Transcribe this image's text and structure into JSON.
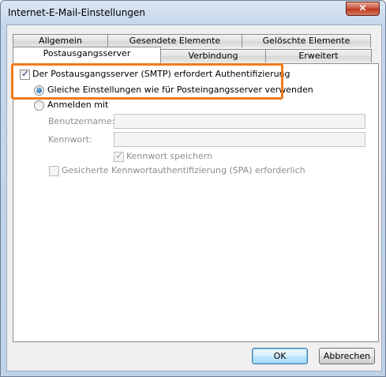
{
  "window": {
    "title": "Internet-E-Mail-Einstellungen",
    "close_icon": "×"
  },
  "tabs": {
    "row1": [
      "Allgemein",
      "Gesendete Elemente",
      "Gelöschte Elemente"
    ],
    "row2": [
      "Postausgangsserver",
      "Verbindung",
      "Erweitert"
    ],
    "active": "Postausgangsserver"
  },
  "smtp_auth": {
    "label": "Der Postausgangsserver (SMTP) erfordert Authentifizierung",
    "checked": true
  },
  "same_settings": {
    "label": "Gleiche Einstellungen wie für Posteingangsserver verwenden",
    "selected": true
  },
  "login_with": {
    "label": "Anmelden mit",
    "selected": false
  },
  "username": {
    "label": "Benutzername:",
    "value": ""
  },
  "password": {
    "label": "Kennwort:",
    "value": ""
  },
  "save_password": {
    "label": "Kennwort speichern",
    "checked": true
  },
  "spa": {
    "label": "Gesicherte Kennwortauthentifizierung (SPA) erforderlich",
    "checked": false
  },
  "buttons": {
    "ok": "OK",
    "cancel": "Abbrechen"
  },
  "colors": {
    "highlight": "#f07b1c",
    "disabled_text": "#8d8d8d"
  }
}
